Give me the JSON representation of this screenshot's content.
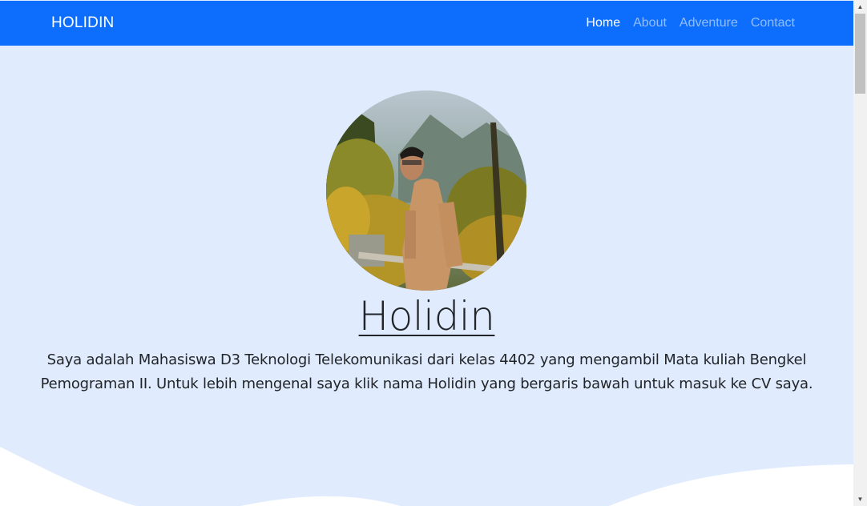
{
  "navbar": {
    "brand": "HOLIDIN",
    "links": [
      {
        "label": "Home",
        "active": true
      },
      {
        "label": "About",
        "active": false
      },
      {
        "label": "Adventure",
        "active": false
      },
      {
        "label": "Contact",
        "active": false
      }
    ]
  },
  "hero": {
    "name": "Holidin",
    "description": "Saya adalah Mahasiswa D3 Teknologi Telekomunikasi dari kelas 4402 yang mengambil Mata kuliah Bengkel Pemograman II. Untuk lebih mengenal saya klik nama Holidin yang bergaris bawah untuk masuk ke CV saya."
  },
  "colors": {
    "navbar": "#0d6efd",
    "hero_background": "#e0ebfd",
    "wave": "#ffffff"
  },
  "icons": {
    "scroll_up": "triangle-up-icon",
    "scroll_down": "triangle-down-icon"
  }
}
